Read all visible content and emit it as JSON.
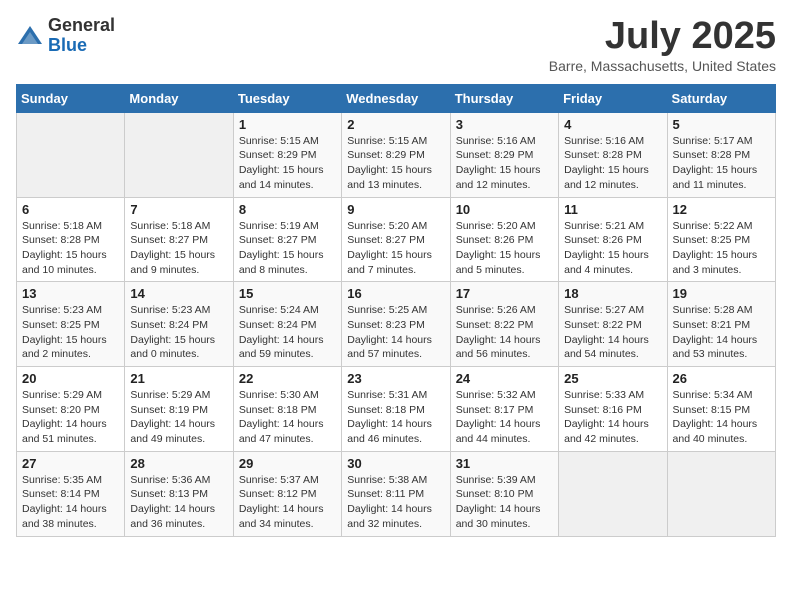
{
  "logo": {
    "general": "General",
    "blue": "Blue"
  },
  "title": "July 2025",
  "location": "Barre, Massachusetts, United States",
  "weekdays": [
    "Sunday",
    "Monday",
    "Tuesday",
    "Wednesday",
    "Thursday",
    "Friday",
    "Saturday"
  ],
  "weeks": [
    [
      {
        "day": "",
        "sunrise": "",
        "sunset": "",
        "daylight": ""
      },
      {
        "day": "",
        "sunrise": "",
        "sunset": "",
        "daylight": ""
      },
      {
        "day": "1",
        "sunrise": "Sunrise: 5:15 AM",
        "sunset": "Sunset: 8:29 PM",
        "daylight": "Daylight: 15 hours and 14 minutes."
      },
      {
        "day": "2",
        "sunrise": "Sunrise: 5:15 AM",
        "sunset": "Sunset: 8:29 PM",
        "daylight": "Daylight: 15 hours and 13 minutes."
      },
      {
        "day": "3",
        "sunrise": "Sunrise: 5:16 AM",
        "sunset": "Sunset: 8:29 PM",
        "daylight": "Daylight: 15 hours and 12 minutes."
      },
      {
        "day": "4",
        "sunrise": "Sunrise: 5:16 AM",
        "sunset": "Sunset: 8:28 PM",
        "daylight": "Daylight: 15 hours and 12 minutes."
      },
      {
        "day": "5",
        "sunrise": "Sunrise: 5:17 AM",
        "sunset": "Sunset: 8:28 PM",
        "daylight": "Daylight: 15 hours and 11 minutes."
      }
    ],
    [
      {
        "day": "6",
        "sunrise": "Sunrise: 5:18 AM",
        "sunset": "Sunset: 8:28 PM",
        "daylight": "Daylight: 15 hours and 10 minutes."
      },
      {
        "day": "7",
        "sunrise": "Sunrise: 5:18 AM",
        "sunset": "Sunset: 8:27 PM",
        "daylight": "Daylight: 15 hours and 9 minutes."
      },
      {
        "day": "8",
        "sunrise": "Sunrise: 5:19 AM",
        "sunset": "Sunset: 8:27 PM",
        "daylight": "Daylight: 15 hours and 8 minutes."
      },
      {
        "day": "9",
        "sunrise": "Sunrise: 5:20 AM",
        "sunset": "Sunset: 8:27 PM",
        "daylight": "Daylight: 15 hours and 7 minutes."
      },
      {
        "day": "10",
        "sunrise": "Sunrise: 5:20 AM",
        "sunset": "Sunset: 8:26 PM",
        "daylight": "Daylight: 15 hours and 5 minutes."
      },
      {
        "day": "11",
        "sunrise": "Sunrise: 5:21 AM",
        "sunset": "Sunset: 8:26 PM",
        "daylight": "Daylight: 15 hours and 4 minutes."
      },
      {
        "day": "12",
        "sunrise": "Sunrise: 5:22 AM",
        "sunset": "Sunset: 8:25 PM",
        "daylight": "Daylight: 15 hours and 3 minutes."
      }
    ],
    [
      {
        "day": "13",
        "sunrise": "Sunrise: 5:23 AM",
        "sunset": "Sunset: 8:25 PM",
        "daylight": "Daylight: 15 hours and 2 minutes."
      },
      {
        "day": "14",
        "sunrise": "Sunrise: 5:23 AM",
        "sunset": "Sunset: 8:24 PM",
        "daylight": "Daylight: 15 hours and 0 minutes."
      },
      {
        "day": "15",
        "sunrise": "Sunrise: 5:24 AM",
        "sunset": "Sunset: 8:24 PM",
        "daylight": "Daylight: 14 hours and 59 minutes."
      },
      {
        "day": "16",
        "sunrise": "Sunrise: 5:25 AM",
        "sunset": "Sunset: 8:23 PM",
        "daylight": "Daylight: 14 hours and 57 minutes."
      },
      {
        "day": "17",
        "sunrise": "Sunrise: 5:26 AM",
        "sunset": "Sunset: 8:22 PM",
        "daylight": "Daylight: 14 hours and 56 minutes."
      },
      {
        "day": "18",
        "sunrise": "Sunrise: 5:27 AM",
        "sunset": "Sunset: 8:22 PM",
        "daylight": "Daylight: 14 hours and 54 minutes."
      },
      {
        "day": "19",
        "sunrise": "Sunrise: 5:28 AM",
        "sunset": "Sunset: 8:21 PM",
        "daylight": "Daylight: 14 hours and 53 minutes."
      }
    ],
    [
      {
        "day": "20",
        "sunrise": "Sunrise: 5:29 AM",
        "sunset": "Sunset: 8:20 PM",
        "daylight": "Daylight: 14 hours and 51 minutes."
      },
      {
        "day": "21",
        "sunrise": "Sunrise: 5:29 AM",
        "sunset": "Sunset: 8:19 PM",
        "daylight": "Daylight: 14 hours and 49 minutes."
      },
      {
        "day": "22",
        "sunrise": "Sunrise: 5:30 AM",
        "sunset": "Sunset: 8:18 PM",
        "daylight": "Daylight: 14 hours and 47 minutes."
      },
      {
        "day": "23",
        "sunrise": "Sunrise: 5:31 AM",
        "sunset": "Sunset: 8:18 PM",
        "daylight": "Daylight: 14 hours and 46 minutes."
      },
      {
        "day": "24",
        "sunrise": "Sunrise: 5:32 AM",
        "sunset": "Sunset: 8:17 PM",
        "daylight": "Daylight: 14 hours and 44 minutes."
      },
      {
        "day": "25",
        "sunrise": "Sunrise: 5:33 AM",
        "sunset": "Sunset: 8:16 PM",
        "daylight": "Daylight: 14 hours and 42 minutes."
      },
      {
        "day": "26",
        "sunrise": "Sunrise: 5:34 AM",
        "sunset": "Sunset: 8:15 PM",
        "daylight": "Daylight: 14 hours and 40 minutes."
      }
    ],
    [
      {
        "day": "27",
        "sunrise": "Sunrise: 5:35 AM",
        "sunset": "Sunset: 8:14 PM",
        "daylight": "Daylight: 14 hours and 38 minutes."
      },
      {
        "day": "28",
        "sunrise": "Sunrise: 5:36 AM",
        "sunset": "Sunset: 8:13 PM",
        "daylight": "Daylight: 14 hours and 36 minutes."
      },
      {
        "day": "29",
        "sunrise": "Sunrise: 5:37 AM",
        "sunset": "Sunset: 8:12 PM",
        "daylight": "Daylight: 14 hours and 34 minutes."
      },
      {
        "day": "30",
        "sunrise": "Sunrise: 5:38 AM",
        "sunset": "Sunset: 8:11 PM",
        "daylight": "Daylight: 14 hours and 32 minutes."
      },
      {
        "day": "31",
        "sunrise": "Sunrise: 5:39 AM",
        "sunset": "Sunset: 8:10 PM",
        "daylight": "Daylight: 14 hours and 30 minutes."
      },
      {
        "day": "",
        "sunrise": "",
        "sunset": "",
        "daylight": ""
      },
      {
        "day": "",
        "sunrise": "",
        "sunset": "",
        "daylight": ""
      }
    ]
  ]
}
